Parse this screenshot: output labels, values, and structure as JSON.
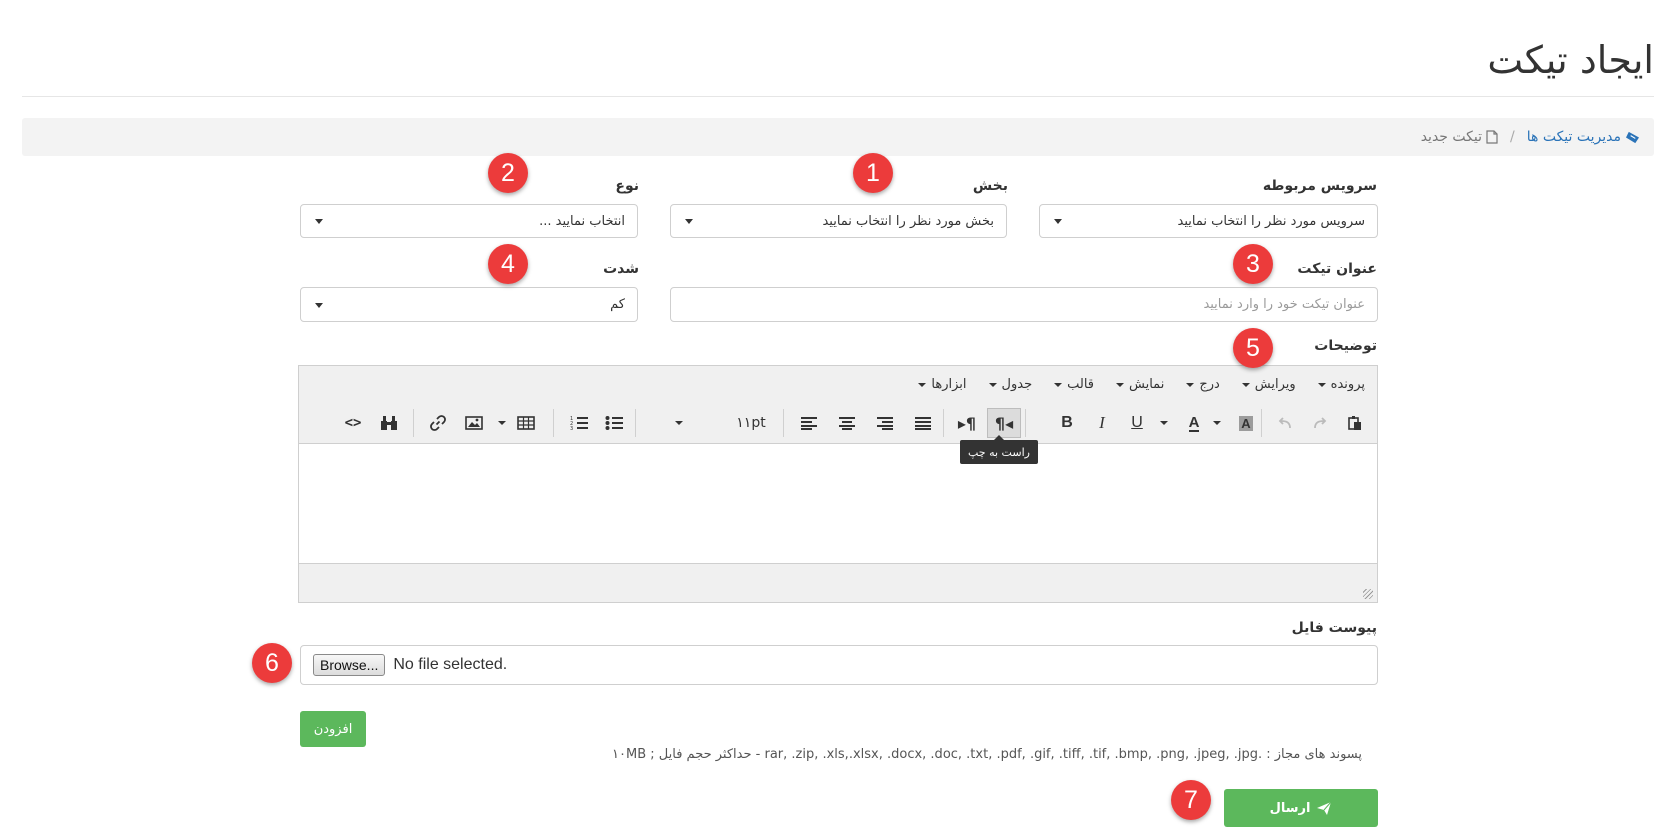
{
  "page_title": "ایجاد تیکت",
  "breadcrumb": {
    "root_label": "مدیریت تیکت ها",
    "separator": "/",
    "current_label": "تیکت جدید"
  },
  "form": {
    "service": {
      "label": "سرویس مربوطه",
      "value": "سرویس مورد نظر را انتخاب نمایید"
    },
    "department": {
      "label": "بخش",
      "value": "بخش مورد نظر را انتخاب نمایید"
    },
    "type": {
      "label": "نوع",
      "value": "انتخاب نمایید ..."
    },
    "subject": {
      "label": "عنوان تیکت",
      "placeholder": "عنوان تیکت خود را وارد نمایید"
    },
    "priority": {
      "label": "شدت",
      "value": "کم"
    },
    "description": {
      "label": "توضیحات"
    },
    "attachment": {
      "label": "پیوست فایل",
      "browse_label": "Browse...",
      "status": "No file selected."
    },
    "add_label": "افزودن",
    "allowed_hint": "پسوند های مجاز : .rar, .zip, .xls,.xlsx, .docx, .doc, .txt, .pdf, .gif, .tiff, .tif, .bmp, .png, .jpeg, .jpg - حداکثر حجم فایل ; ۱۰MB",
    "submit_label": "ارسال"
  },
  "editor": {
    "menus": [
      "پرونده",
      "ویرایش",
      "درج",
      "نمایش",
      "قالب",
      "جدول",
      "ابزارها"
    ],
    "font_size": "۱۱pt",
    "tooltip": "راست به چپ"
  },
  "annotations": [
    "1",
    "2",
    "3",
    "4",
    "5",
    "6",
    "7"
  ],
  "colors": {
    "accent_green": "#5cb85c",
    "badge_red": "#ec3b3b",
    "link_blue": "#2a73b8"
  }
}
